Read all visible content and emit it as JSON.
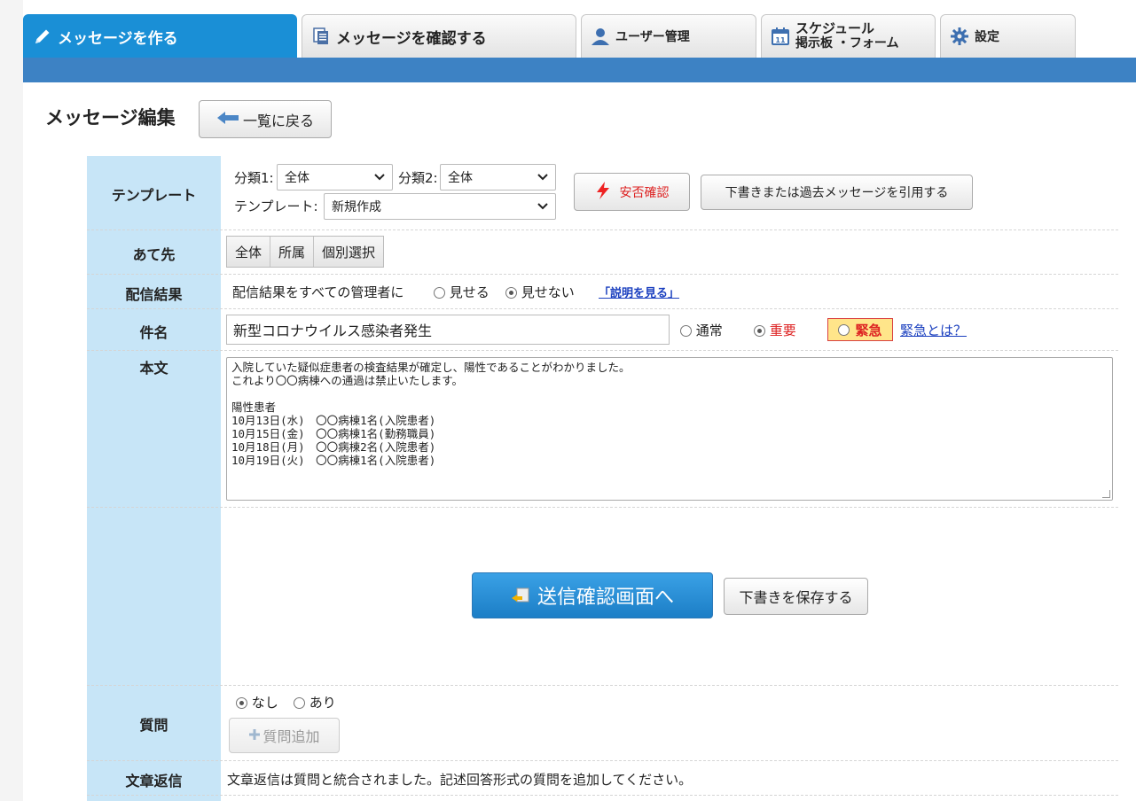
{
  "tabs": [
    {
      "label": "メッセージを作る",
      "icon": "pencil-icon",
      "active": true
    },
    {
      "label": "メッセージを確認する",
      "icon": "document-list-icon"
    },
    {
      "label": "ユーザー管理",
      "icon": "user-icon"
    },
    {
      "label_line1": "スケジュール",
      "label_line2": "掲示板 ・フォーム",
      "icon": "calendar-icon"
    },
    {
      "label": "設定",
      "icon": "gear-icon"
    }
  ],
  "page": {
    "title": "メッセージ編集",
    "back_label": "一覧に戻る"
  },
  "template_row": {
    "label": "テンプレート",
    "cat1_label": "分類1:",
    "cat1_value": "全体",
    "cat2_label": "分類2:",
    "cat2_value": "全体",
    "template_label": "テンプレート:",
    "template_value": "新規作成",
    "safety_label": "安否確認",
    "quote_label": "下書きまたは過去メッセージを引用する"
  },
  "dest_row": {
    "label": "あて先",
    "options": [
      "全体",
      "所属",
      "個別選択"
    ]
  },
  "result_row": {
    "label": "配信結果",
    "text": "配信結果をすべての管理者に",
    "show_label": "見せる",
    "hide_label": "見せない",
    "help_link": "「説明を見る」"
  },
  "subject_row": {
    "label": "件名",
    "value": "新型コロナウイルス感染者発生",
    "normal_label": "通常",
    "important_label": "重要",
    "urgent_label": "緊急",
    "urgent_help": "緊急とは？"
  },
  "body_row": {
    "label": "本文",
    "value": "入院していた疑似症患者の検査結果が確定し、陽性であることがわかりました。\nこれより〇〇病棟への通過は禁止いたします。\n\n陽性患者\n10月13日(水)　〇〇病棟1名(入院患者)\n10月15日(金)　〇〇病棟1名(勤務職員)\n10月18日(月)　〇〇病棟2名(入院患者)\n10月19日(火)　〇〇病棟1名(入院患者)"
  },
  "actions": {
    "send_label": "送信確認画面へ",
    "save_label": "下書きを保存する"
  },
  "question_row": {
    "label": "質問",
    "none_label": "なし",
    "yes_label": "あり",
    "add_label": "質問追加"
  },
  "text_reply_row": {
    "label": "文章返信",
    "text": "文章返信は質問と統合されました。記述回答形式の質問を追加してください。"
  },
  "colors": {
    "tab_active": "#1a8fd6",
    "header_bar": "#3d82c4",
    "label_column": "#c7e5f7",
    "important_red": "#d22222",
    "urgent_bg": "#ffe58a"
  }
}
